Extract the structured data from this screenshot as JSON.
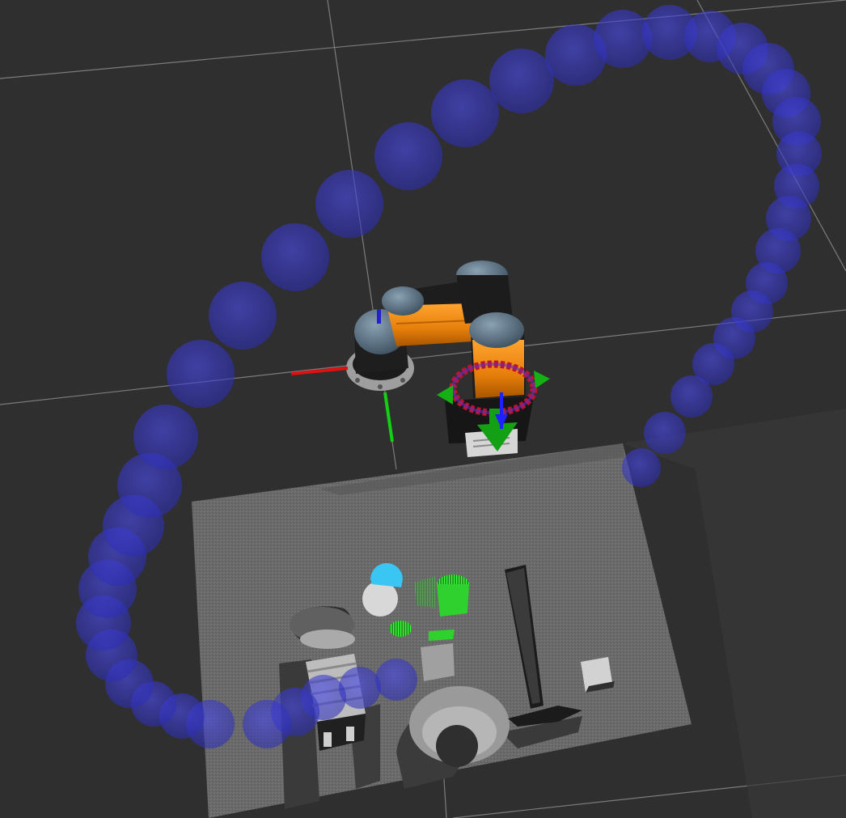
{
  "app": {
    "title": ""
  },
  "colors": {
    "background": "#2f2f2f",
    "grid": "#8a8a8a",
    "waypoint_sphere": "#3b3bd6",
    "robot_link": "#ef8a12",
    "robot_joint_cap": "#5a6f80",
    "robot_dark": "#1a1a1a",
    "axis_x": "#e01010",
    "axis_y": "#12d012",
    "axis_z": "#1010e0",
    "table_surface": "#6d6d6d",
    "highlight_object": "#33d633",
    "cyan_object": "#39c6f2"
  },
  "scene": {
    "waypoint_marker": {
      "icon": "sphere-icon",
      "style": "translucent"
    },
    "robot": {
      "name": ""
    },
    "interactive_marker": {
      "icon": "ring-arrows-icon"
    },
    "table_pointcloud": {
      "icon": "pointcloud-icon"
    }
  }
}
